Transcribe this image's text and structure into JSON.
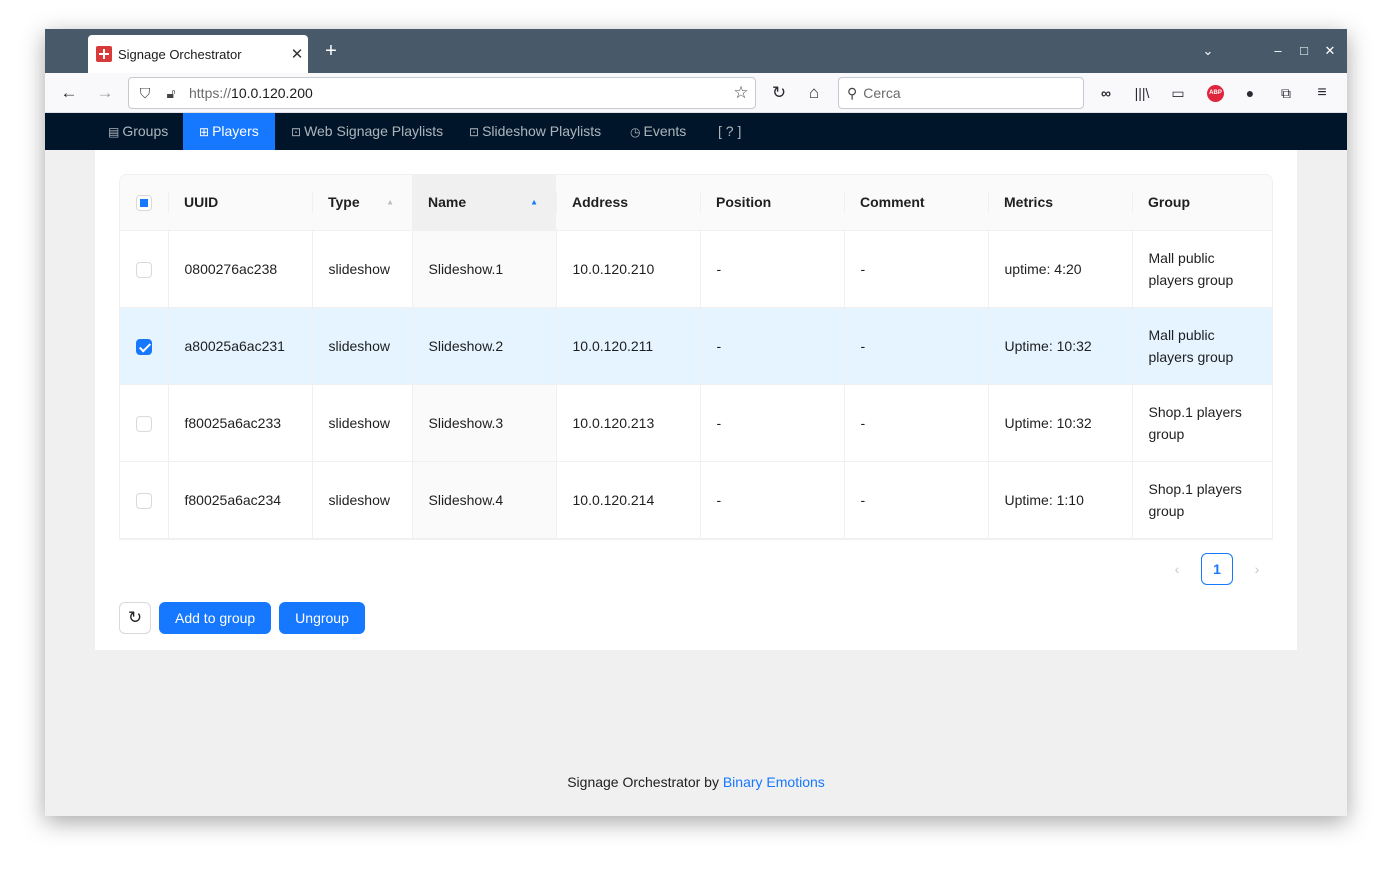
{
  "browser": {
    "tab_title": "Signage Orchestrator",
    "tab_close": "✕",
    "new_tab": "+",
    "url_prefix": "https://",
    "url_host": "10.0.120.200",
    "search_placeholder": "Cerca"
  },
  "appnav": {
    "items": [
      {
        "label": "Groups",
        "icon": "groups-icon"
      },
      {
        "label": "Players",
        "icon": "players-icon",
        "active": true
      },
      {
        "label": "Web Signage Playlists",
        "icon": "web-playlists-icon"
      },
      {
        "label": "Slideshow Playlists",
        "icon": "slideshow-playlists-icon"
      },
      {
        "label": "Events",
        "icon": "events-icon"
      },
      {
        "label": "[ ? ]"
      }
    ]
  },
  "table": {
    "columns": [
      "UUID",
      "Type",
      "Name",
      "Address",
      "Position",
      "Comment",
      "Metrics",
      "Group"
    ],
    "rows": [
      {
        "checked": false,
        "uuid": "0800276ac238",
        "type": "slideshow",
        "name": "Slideshow.1",
        "address": "10.0.120.210",
        "position": "-",
        "comment": "-",
        "metrics": "uptime: 4:20",
        "group": "Mall public players group"
      },
      {
        "checked": true,
        "uuid": "a80025a6ac231",
        "type": "slideshow",
        "name": "Slideshow.2",
        "address": "10.0.120.211",
        "position": "-",
        "comment": "-",
        "metrics": "Uptime: 10:32",
        "group": "Mall public players group"
      },
      {
        "checked": false,
        "uuid": "f80025a6ac233",
        "type": "slideshow",
        "name": "Slideshow.3",
        "address": "10.0.120.213",
        "position": "-",
        "comment": "-",
        "metrics": "Uptime: 10:32",
        "group": "Shop.1 players group"
      },
      {
        "checked": false,
        "uuid": "f80025a6ac234",
        "type": "slideshow",
        "name": "Slideshow.4",
        "address": "10.0.120.214",
        "position": "-",
        "comment": "-",
        "metrics": "Uptime: 1:10",
        "group": "Shop.1 players group"
      }
    ]
  },
  "pagination": {
    "current": "1"
  },
  "actions": {
    "add_to_group": "Add to group",
    "ungroup": "Ungroup"
  },
  "footer": {
    "prefix": "Signage Orchestrator by ",
    "link": "Binary Emotions"
  },
  "colors": {
    "nav_bg": "#001529",
    "primary": "#1677ff",
    "selected_row": "#e6f4ff",
    "titlebar": "#48596a"
  }
}
